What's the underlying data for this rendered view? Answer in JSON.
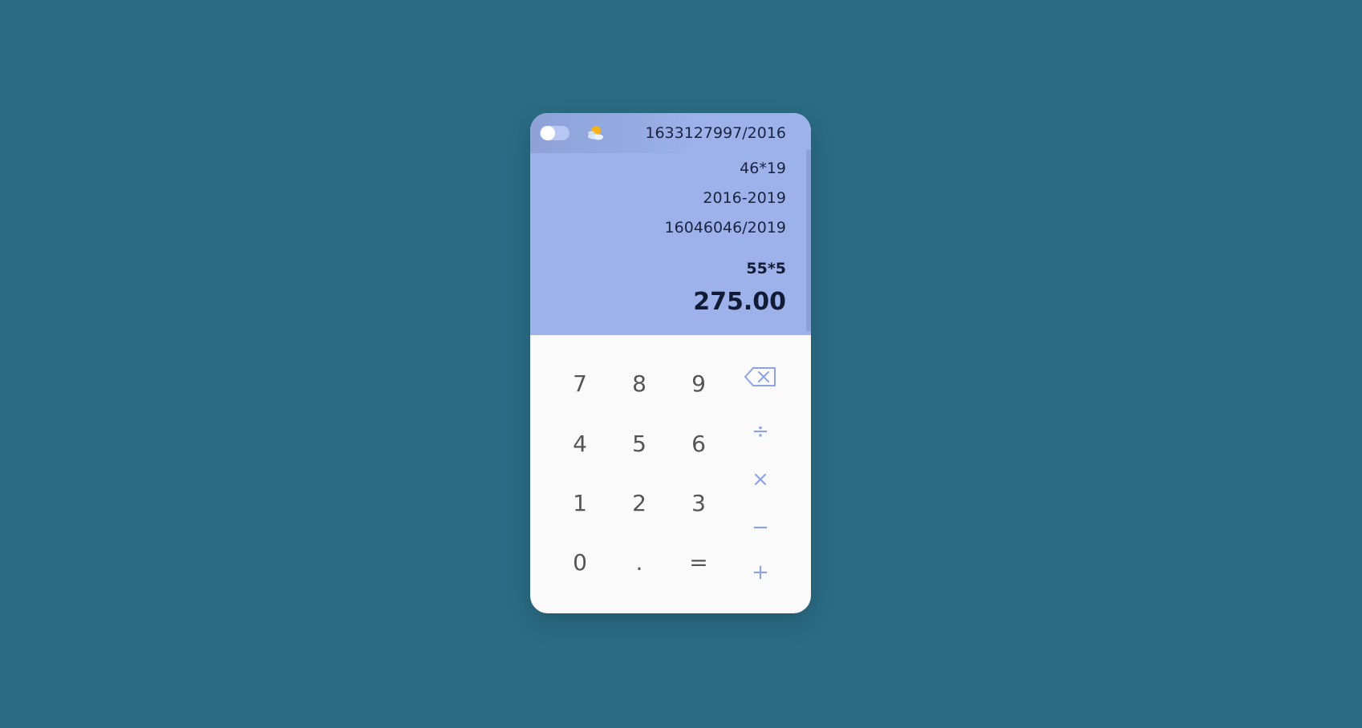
{
  "topbar": {
    "theme_toggle_state": "off",
    "weather_icon": "partly-cloudy-icon"
  },
  "display": {
    "history": [
      "1633127997/2016",
      "46*19",
      "2016-2019",
      "16046046/2019"
    ],
    "expression": "55*5",
    "result": "275.00"
  },
  "keypad": {
    "digits": {
      "seven": "7",
      "eight": "8",
      "nine": "9",
      "four": "4",
      "five": "5",
      "six": "6",
      "one": "1",
      "two": "2",
      "three": "3",
      "zero": "0",
      "decimal": ".",
      "equals": "="
    },
    "operators": {
      "backspace_icon": "backspace-icon",
      "divide": "÷",
      "multiply": "×",
      "subtract": "−",
      "add": "+"
    }
  },
  "colors": {
    "page_background": "#2b6c84",
    "display_background": "#9db2eb",
    "keypad_background": "#fafafa",
    "operator_color": "#8ea2e6",
    "digit_color": "#555555",
    "text_dark": "#141b35"
  }
}
